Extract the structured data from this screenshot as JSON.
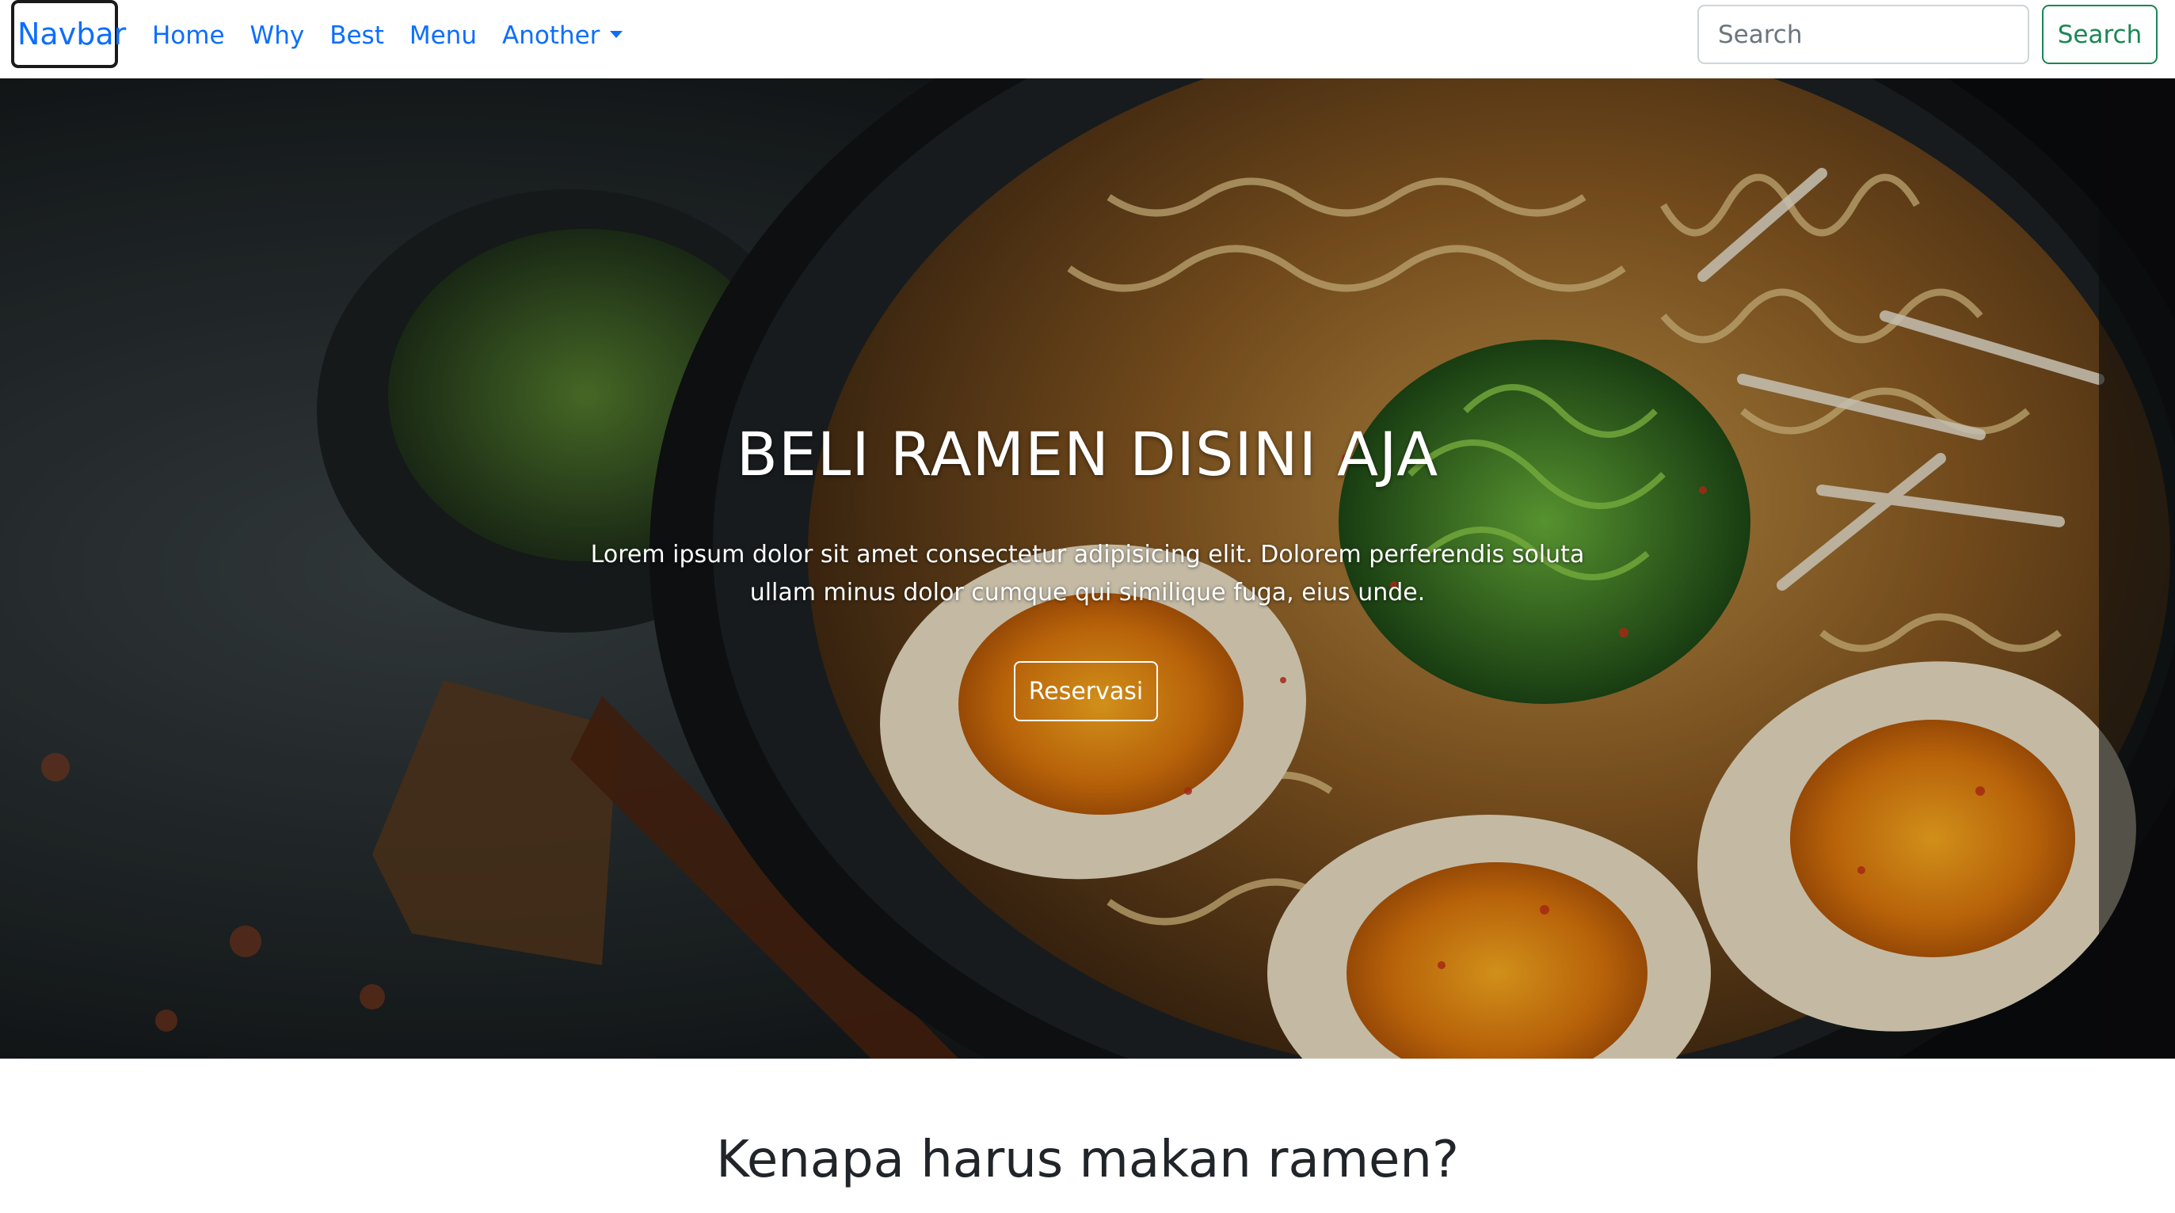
{
  "navbar": {
    "brand": "Navbar",
    "links": [
      "Home",
      "Why",
      "Best",
      "Menu"
    ],
    "dropdown_label": "Another",
    "search_placeholder": "Search",
    "search_button": "Search"
  },
  "hero": {
    "title": "BELI RAMEN DISINI AJA",
    "text": "Lorem ipsum dolor sit amet consectetur adipisicing elit. Dolorem perferendis soluta ullam minus dolor cumque qui similique fuga, eius unde.",
    "button": "Reservasi"
  },
  "section": {
    "title": "Kenapa harus makan ramen?"
  },
  "colors": {
    "link": "#0d6efd",
    "success": "#198754"
  }
}
